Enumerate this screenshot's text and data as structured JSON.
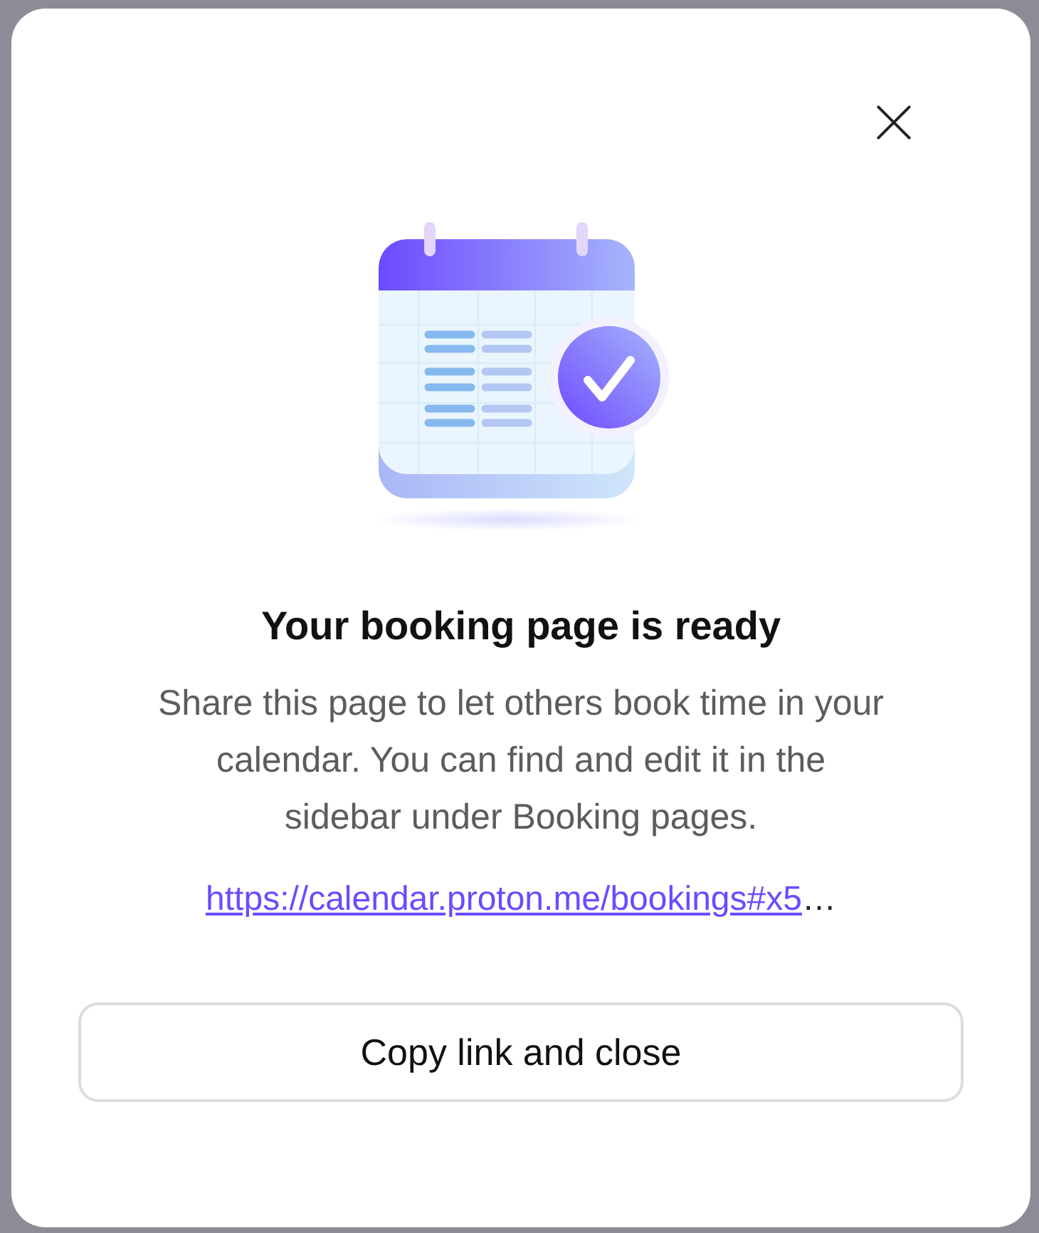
{
  "dialog": {
    "title": "Your booking page is ready",
    "message": "Share this page to let others book time in your calendar. You can find and edit it in the sidebar under Booking pages.",
    "link": {
      "text": "https://calendar.proton.me/bookings#x5",
      "overflow_mark": "…"
    },
    "button": "Copy link and close"
  }
}
